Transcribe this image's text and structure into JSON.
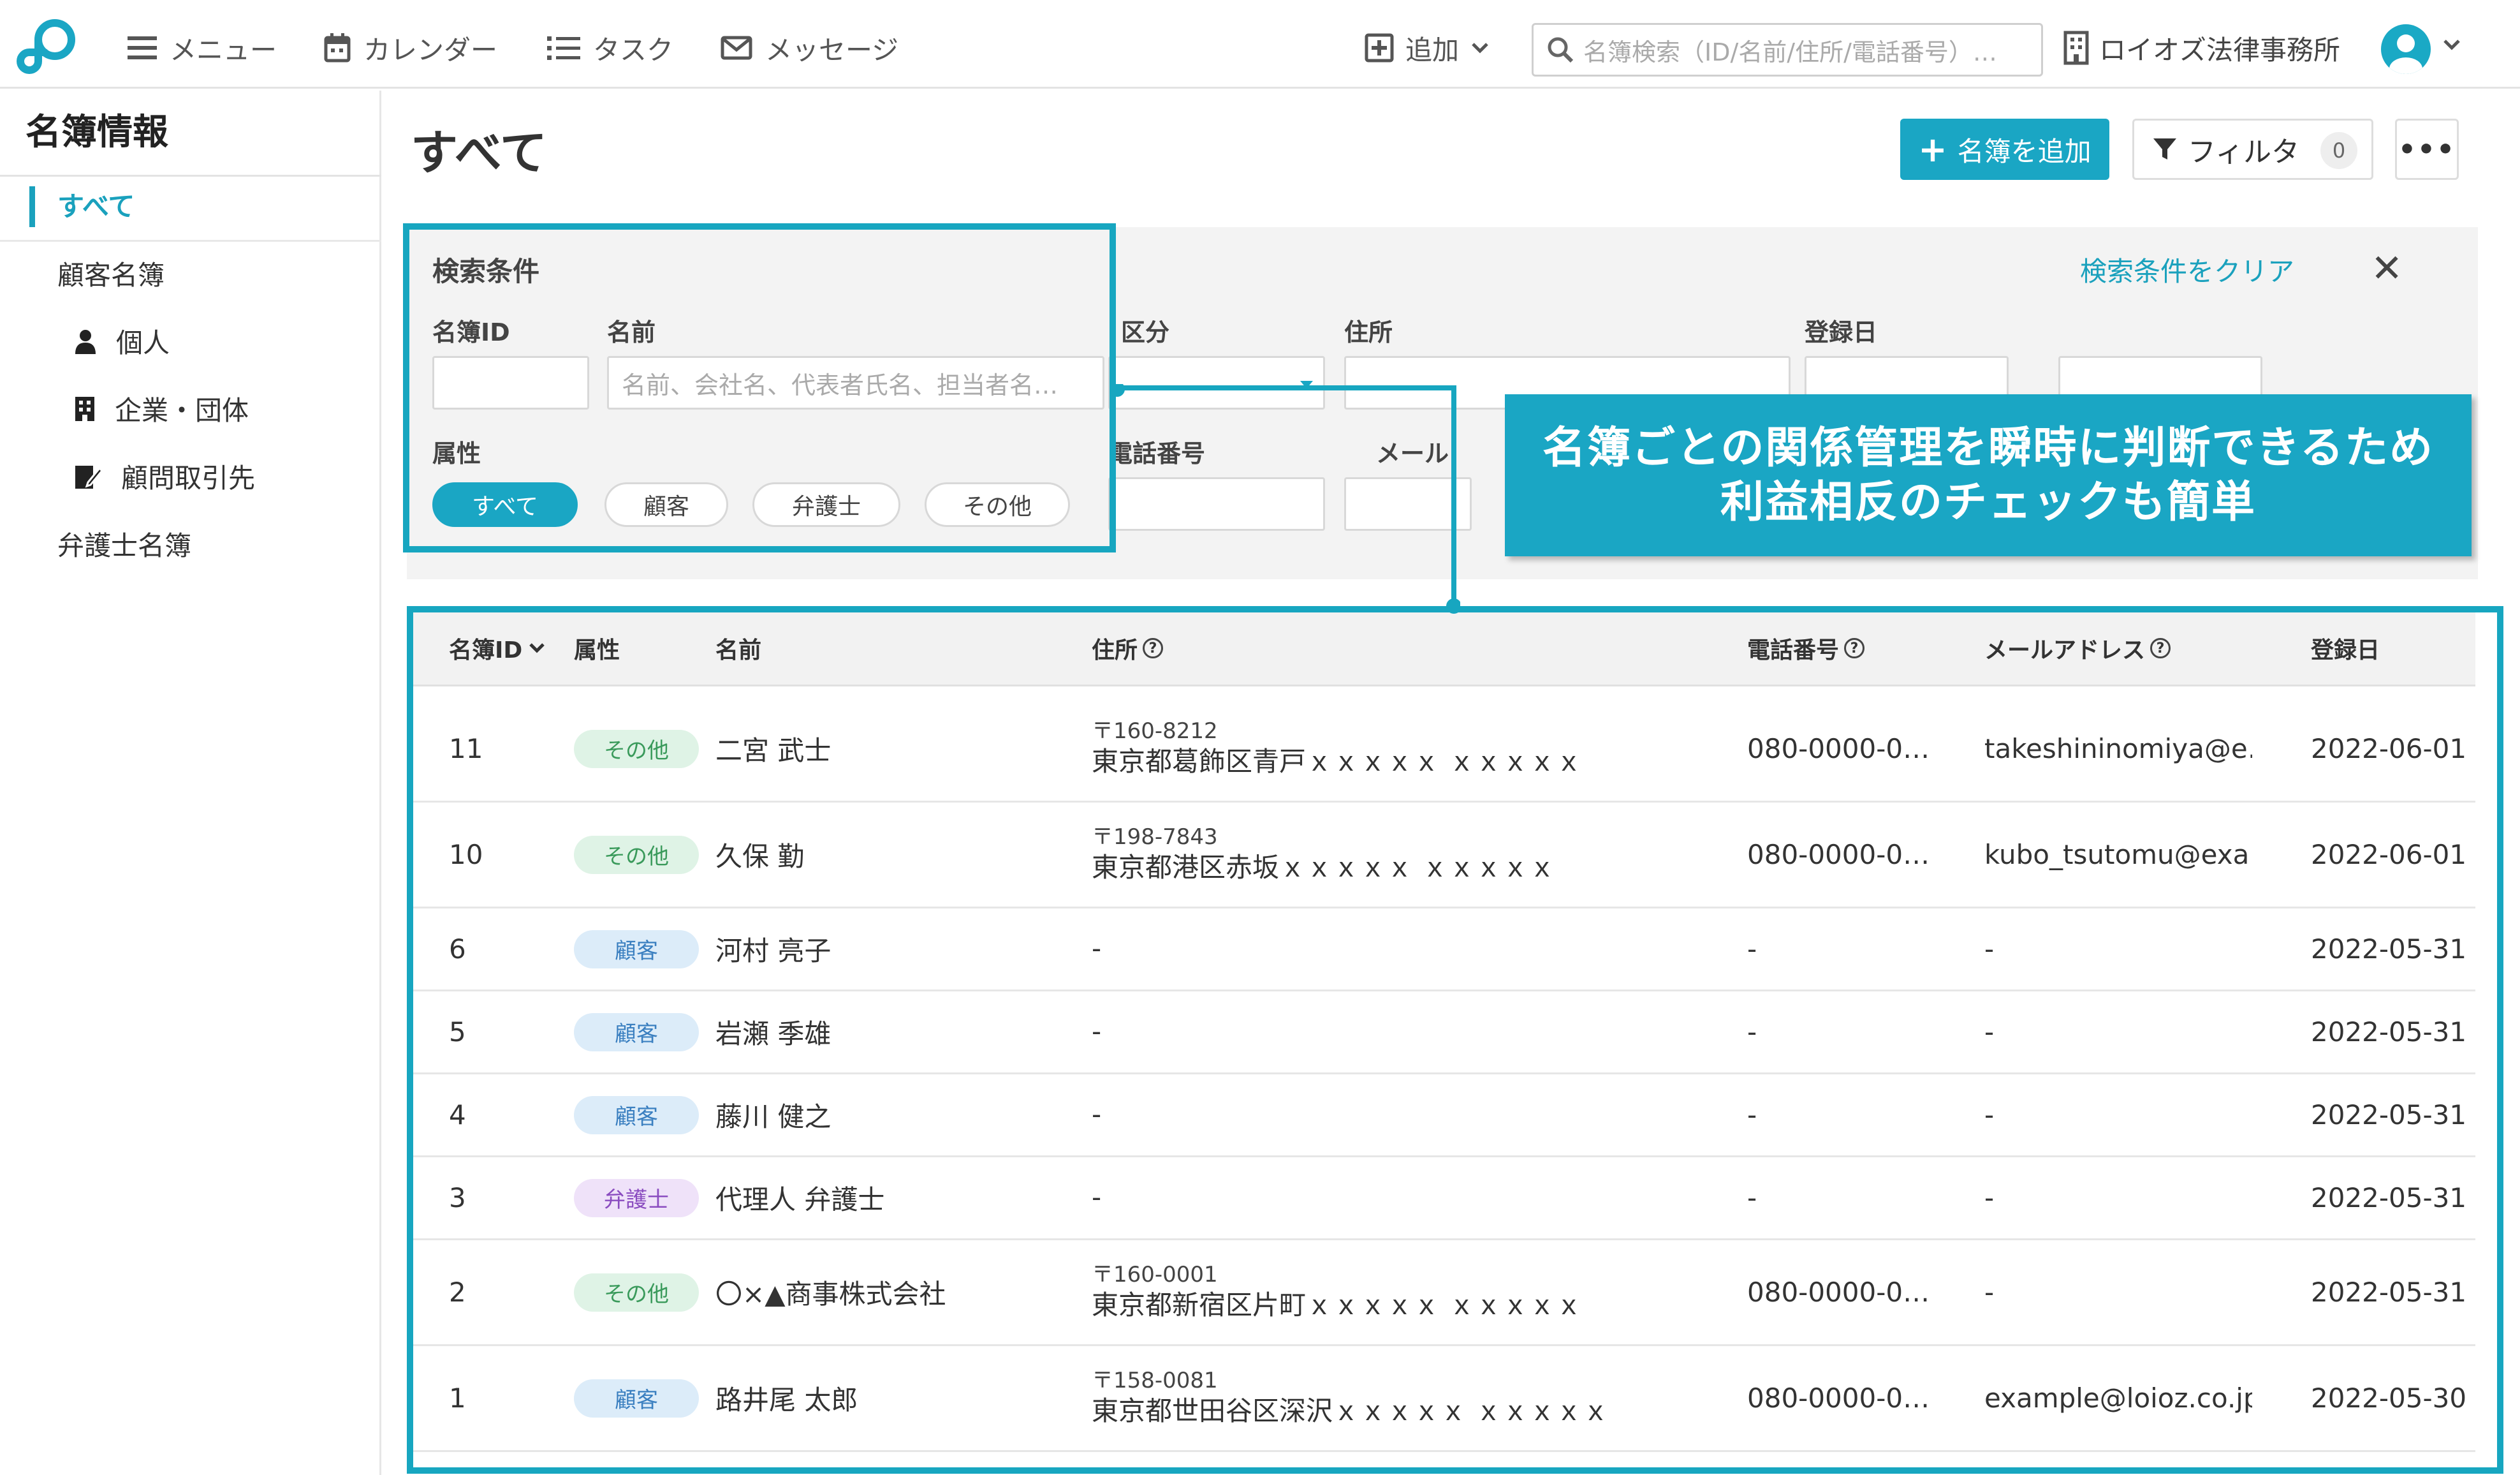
{
  "topbar": {
    "nav": [
      "メニュー",
      "カレンダー",
      "タスク",
      "メッセージ"
    ],
    "add_label": "追加",
    "search_placeholder": "名簿検索（ID/名前/住所/電話番号）…",
    "org_name": "ロイオズ法律事務所"
  },
  "sidebar": {
    "title": "名簿情報",
    "items": [
      "すべて",
      "顧客名簿",
      "個人",
      "企業・団体",
      "顧問取引先",
      "弁護士名簿"
    ]
  },
  "main": {
    "title": "すべて",
    "add_button": "名簿を追加",
    "filter_button": "フィルタ",
    "filter_count": "0",
    "more_button": "•••"
  },
  "filter_panel": {
    "title": "検索条件",
    "labels": {
      "id": "名簿ID",
      "name": "名前",
      "kubun": "区分",
      "address": "住所",
      "regdate": "登録日",
      "attr": "属性",
      "phone": "電話番号",
      "mail": "メール"
    },
    "name_placeholder": "名前、会社名、代表者氏名、担当者名…",
    "chips": [
      "すべて",
      "顧客",
      "弁護士",
      "その他"
    ],
    "clear_label": "検索条件をクリア"
  },
  "table": {
    "headers": [
      "名簿ID",
      "属性",
      "名前",
      "住所",
      "電話番号",
      "メールアドレス",
      "登録日"
    ],
    "rows": [
      {
        "id": "11",
        "attr": "その他",
        "name": "二宮 武士",
        "zip": "〒160-8212",
        "address": "東京都葛飾区青戸ｘｘｘｘｘ ｘｘｘｘｘ",
        "phone": "080-0000-0…",
        "email": "takeshininomiya@e…",
        "date": "2022-06-01"
      },
      {
        "id": "10",
        "attr": "その他",
        "name": "久保 勤",
        "zip": "〒198-7843",
        "address": "東京都港区赤坂ｘｘｘｘｘ ｘｘｘｘｘ",
        "phone": "080-0000-0…",
        "email": "kubo_tsutomu@exa…",
        "date": "2022-06-01"
      },
      {
        "id": "6",
        "attr": "顧客",
        "name": "河村 亮子",
        "zip": "",
        "address": "-",
        "phone": "-",
        "email": "-",
        "date": "2022-05-31"
      },
      {
        "id": "5",
        "attr": "顧客",
        "name": "岩瀬 季雄",
        "zip": "",
        "address": "-",
        "phone": "-",
        "email": "-",
        "date": "2022-05-31"
      },
      {
        "id": "4",
        "attr": "顧客",
        "name": "藤川 健之",
        "zip": "",
        "address": "-",
        "phone": "-",
        "email": "-",
        "date": "2022-05-31"
      },
      {
        "id": "3",
        "attr": "弁護士",
        "name": "代理人 弁護士",
        "zip": "",
        "address": "-",
        "phone": "-",
        "email": "-",
        "date": "2022-05-31"
      },
      {
        "id": "2",
        "attr": "その他",
        "name": "〇×▲商事株式会社",
        "zip": "〒160-0001",
        "address": "東京都新宿区片町ｘｘｘｘｘ ｘｘｘｘｘ",
        "phone": "080-0000-0…",
        "email": "-",
        "date": "2022-05-31"
      },
      {
        "id": "1",
        "attr": "顧客",
        "name": "路井尾 太郎",
        "zip": "〒158-0081",
        "address": "東京都世田谷区深沢ｘｘｘｘｘ ｘｘｘｘｘ",
        "phone": "080-0000-0…",
        "email": "example@loioz.co.jp",
        "date": "2022-05-30"
      }
    ]
  },
  "badge_colors": {
    "その他": {
      "bg": "#dff3e6",
      "fg": "#3a9a5b"
    },
    "顧客": {
      "bg": "#dcecf9",
      "fg": "#3a7fc0"
    },
    "弁護士": {
      "bg": "#efe2f9",
      "fg": "#8a4cc0"
    }
  },
  "callout": {
    "line1": "名簿ごとの関係管理を瞬時に判断できるため",
    "line2": "利益相反のチェックも簡単"
  },
  "accent_color": "#1aa6c4"
}
